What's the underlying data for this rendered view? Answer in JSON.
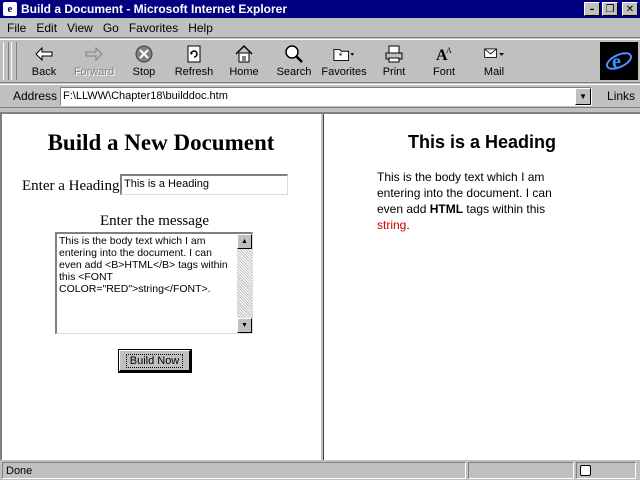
{
  "window": {
    "title": "Build a Document - Microsoft Internet Explorer"
  },
  "menu": [
    "File",
    "Edit",
    "View",
    "Go",
    "Favorites",
    "Help"
  ],
  "toolbar": {
    "back": "Back",
    "forward": "Forward",
    "stop": "Stop",
    "refresh": "Refresh",
    "home": "Home",
    "search": "Search",
    "favorites": "Favorites",
    "print": "Print",
    "font": "Font",
    "mail": "Mail"
  },
  "address": {
    "label": "Address",
    "value": "F:\\LLWW\\Chapter18\\builddoc.htm",
    "links": "Links"
  },
  "left_frame": {
    "title": "Build a New Document",
    "heading_label": "Enter a Heading",
    "heading_value": "This is a Heading",
    "message_label": "Enter the message",
    "message_value": "This is the body text which I am entering into the document. I can even add <B>HTML</B> tags within this <FONT COLOR=\"RED\">string</FONT>.",
    "button_label": "Build Now"
  },
  "right_frame": {
    "heading": "This is a Heading",
    "body_pre": "This is the body text which I am entering into the document. I can even add ",
    "body_bold": "HTML",
    "body_mid": " tags within this ",
    "body_red": "string",
    "body_end": ".",
    "red_color": "#cc0000"
  },
  "status": {
    "text": "Done"
  }
}
